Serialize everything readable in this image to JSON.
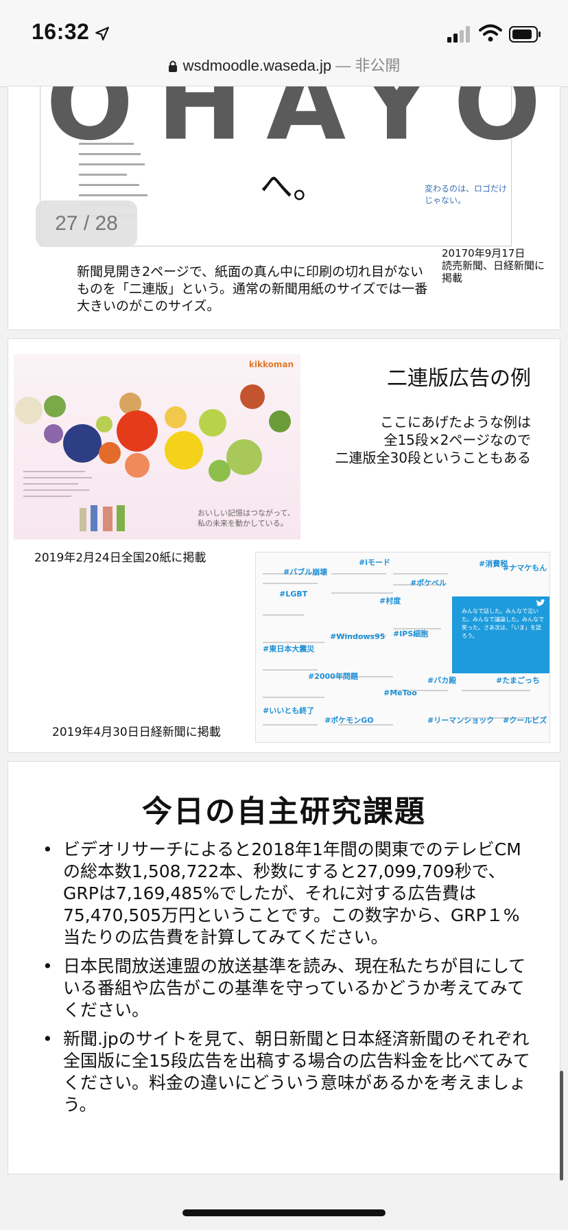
{
  "status": {
    "time": "16:32",
    "url": "wsdmoodle.waseda.jp",
    "url_suffix": " — 非公開"
  },
  "viewer": {
    "page_indicator": "27 / 28"
  },
  "slide1": {
    "ad_headline": "OHAYO",
    "ad_mark": "へ。",
    "ad_tagline": "変わるのは、ロゴだけじゃない。",
    "date": "20170年9月17日",
    "date_note": "読売新聞、日経新聞に掲載",
    "caption": "新聞見開き2ページで、紙面の真ん中に印刷の切れ目がないものを「二連版」という。通常の新聞用紙のサイズでは一番大きいのがこのサイズ。"
  },
  "slide2": {
    "title": "二連版広告の例",
    "desc_line1": "ここにあげたような例は",
    "desc_line2": "全15段×2ページなので",
    "desc_line3": "二連版全30段ということもある",
    "kikkoman_logo": "kikkoman",
    "kikkoman_copy_line1": "おいしい記憶はつながって、",
    "kikkoman_copy_line2": "私の未来を動かしている。",
    "caption_a": "2019年2月24日全国20紙に掲載",
    "caption_b": "2019年4月30日日経新聞に掲載",
    "twitter_tags": [
      "#バブル崩壊",
      "#iモード",
      "#ポケベル",
      "#消費税",
      "#LGBT",
      "#村度",
      "#IPS細胞",
      "#Windows95",
      "#東日本大震災",
      "#2000年問題",
      "#MeToo",
      "#バカ殿",
      "#たまごっち",
      "#いいとも終了",
      "#ポケモンGO",
      "#リーマンショック",
      "#クールビズ",
      "#ナマケもん"
    ],
    "twitter_copy": "みんなで話した。みんなで泣いた。みんなで議論した。みんなで笑った。さあ次は、「いま」を語ろう。"
  },
  "slide3": {
    "title": "今日の自主研究課題",
    "bullets": [
      "ビデオリサーチによると2018年1年間の関東でのテレビCMの総本数1,508,722本、秒数にすると27,099,709秒で、GRPは7,169,485%でしたが、それに対する広告費は75,470,505万円ということです。この数字から、GRP１%当たりの広告費を計算してみてください。",
      "日本民間放送連盟の放送基準を読み、現在私たちが目にしている番組や広告がこの基準を守っているかどうか考えてみてください。",
      "新聞.jpのサイトを見て、朝日新聞と日本経済新聞のそれぞれ全国版に全15段広告を出稿する場合の広告料金を比べてみてください。料金の違いにどういう意味があるかを考えましょう。"
    ],
    "bullet_glyph": "•"
  },
  "colors": {
    "accent_blue": "#1d9bdc",
    "badge_text": "#777777"
  }
}
